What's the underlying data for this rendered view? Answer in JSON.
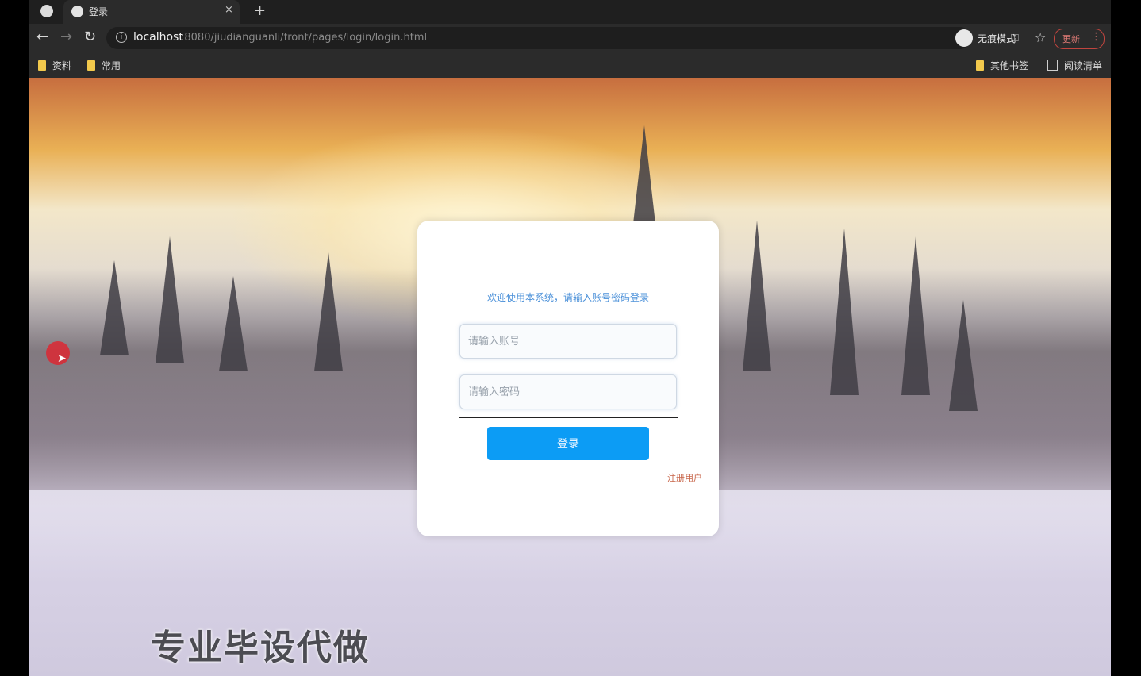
{
  "browser": {
    "tab": {
      "title": "登录",
      "close": "×"
    },
    "new_tab": "+",
    "nav": {
      "back": "←",
      "forward": "→",
      "reload": "↻"
    },
    "url": {
      "host": "localhost",
      "rest": ":8080/jiudianguanli/front/pages/login/login.html"
    },
    "incognito_label": "无痕模式",
    "update_label": "更新",
    "bookmarks_left": [
      "资料",
      "常用"
    ],
    "bookmarks_right": {
      "other": "其他书签",
      "reading_list": "阅读清单"
    }
  },
  "login": {
    "hint": "欢迎使用本系统，请输入账号密码登录",
    "account_placeholder": "请输入账号",
    "password_placeholder": "请输入密码",
    "login_button": "登录",
    "register_link": "注册用户"
  },
  "overlay": {
    "watermark": "专业毕设代做"
  },
  "colors": {
    "accent": "#0c9cf5",
    "register_link": "#c8664a",
    "hint": "#4a90d9"
  }
}
